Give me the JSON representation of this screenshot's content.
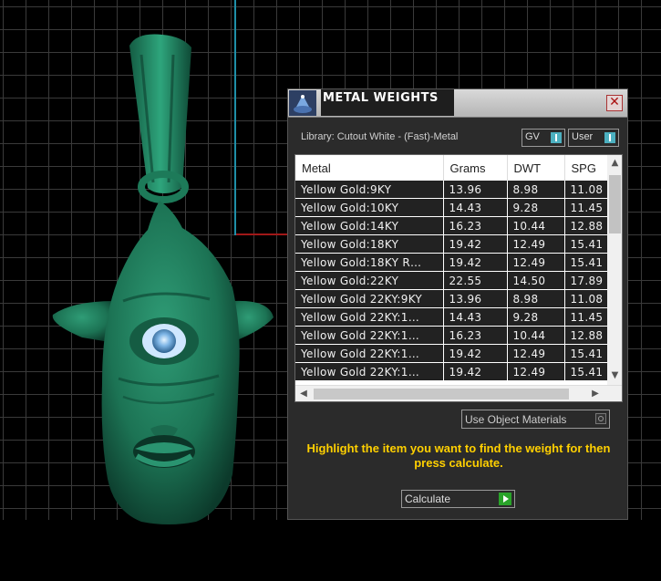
{
  "panel": {
    "title": "METAL WEIGHTS",
    "close_glyph": "✕",
    "library": "Library: Cutout White - (Fast)-Metal",
    "gv_label": "GV",
    "user_label": "User",
    "columns": [
      "Metal",
      "Grams",
      "DWT",
      "SPG"
    ],
    "rows": [
      {
        "metal": "Yellow Gold:9KY",
        "grams": "13.96",
        "dwt": "8.98",
        "spg": "11.08"
      },
      {
        "metal": "Yellow Gold:10KY",
        "grams": "14.43",
        "dwt": "9.28",
        "spg": "11.45"
      },
      {
        "metal": "Yellow Gold:14KY",
        "grams": "16.23",
        "dwt": "10.44",
        "spg": "12.88"
      },
      {
        "metal": "Yellow Gold:18KY",
        "grams": "19.42",
        "dwt": "12.49",
        "spg": "15.41"
      },
      {
        "metal": "Yellow Gold:18KY R…",
        "grams": "19.42",
        "dwt": "12.49",
        "spg": "15.41"
      },
      {
        "metal": "Yellow Gold:22KY",
        "grams": "22.55",
        "dwt": "14.50",
        "spg": "17.89"
      },
      {
        "metal": "Yellow Gold 22KY:9KY",
        "grams": "13.96",
        "dwt": "8.98",
        "spg": "11.08"
      },
      {
        "metal": "Yellow Gold 22KY:1…",
        "grams": "14.43",
        "dwt": "9.28",
        "spg": "11.45"
      },
      {
        "metal": "Yellow Gold 22KY:1…",
        "grams": "16.23",
        "dwt": "10.44",
        "spg": "12.88"
      },
      {
        "metal": "Yellow Gold 22KY:1…",
        "grams": "19.42",
        "dwt": "12.49",
        "spg": "15.41"
      },
      {
        "metal": "Yellow Gold 22KY:1…",
        "grams": "19.42",
        "dwt": "12.49",
        "spg": "15.41"
      }
    ],
    "use_object_materials": "Use Object Materials",
    "hint": "Highlight the item you want to find the weight for then press calculate.",
    "calculate_label": "Calculate"
  },
  "colors": {
    "hint_text": "#ffd000",
    "toggle_indicator": "#4cb0c0",
    "calculate_play": "#29a329",
    "model_green": "#1f7a5c"
  }
}
